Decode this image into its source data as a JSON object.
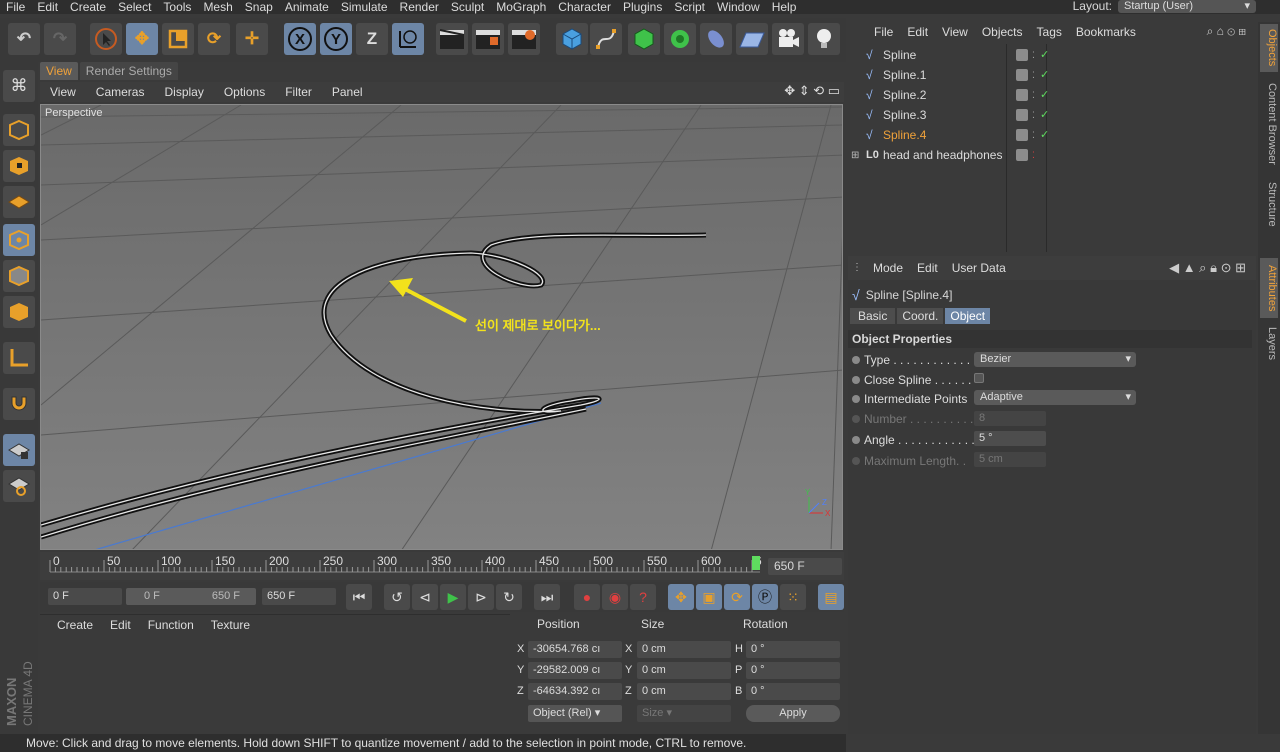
{
  "menubar": {
    "items": [
      "File",
      "Edit",
      "Create",
      "Select",
      "Tools",
      "Mesh",
      "Snap",
      "Animate",
      "Simulate",
      "Render",
      "Sculpt",
      "MoGraph",
      "Character",
      "Plugins",
      "Script",
      "Window",
      "Help"
    ],
    "layout_label": "Layout:",
    "layout_value": "Startup (User)"
  },
  "toolbar": {
    "icons": [
      "undo-icon",
      "redo-icon",
      "live-selection-icon",
      "move-icon",
      "scale-icon",
      "rotate-icon",
      "recent-tools-icon",
      "x-axis-lock",
      "y-axis-lock",
      "z-axis-lock",
      "world-coordinates-icon",
      "render-view-icon",
      "render-picture-viewer-icon",
      "edit-render-settings-icon",
      "cube-icon",
      "pen-icon",
      "subdivision-surface-icon",
      "array-icon",
      "deformer-icon",
      "floor-icon",
      "camera-icon",
      "light-icon"
    ],
    "x_label": "X",
    "y_label": "Y",
    "z_label": "Z"
  },
  "viewport": {
    "tabs": [
      "View",
      "Render Settings"
    ],
    "menu": [
      "View",
      "Cameras",
      "Display",
      "Options",
      "Filter",
      "Panel"
    ],
    "label": "Perspective",
    "annotation": "선이 제대로 보이다가..."
  },
  "timeline": {
    "ticks": [
      "0",
      "50",
      "100",
      "150",
      "200",
      "250",
      "300",
      "350",
      "400",
      "450",
      "500",
      "550",
      "600",
      "6"
    ],
    "end_field": "650 F"
  },
  "transport": {
    "start": "0 F",
    "range_start": "0 F",
    "range_end": "650 F",
    "end": "650 F"
  },
  "material": {
    "menu": [
      "Create",
      "Edit",
      "Function",
      "Texture"
    ]
  },
  "coordinates": {
    "headers": [
      "Position",
      "Size",
      "Rotation"
    ],
    "rows": [
      {
        "axis": "X",
        "pos": "-30654.768 cı",
        "size_axis": "X",
        "size": "0 cm",
        "rot_axis": "H",
        "rot": "0 °"
      },
      {
        "axis": "Y",
        "pos": "-29582.009 cı",
        "size_axis": "Y",
        "size": "0 cm",
        "rot_axis": "P",
        "rot": "0 °"
      },
      {
        "axis": "Z",
        "pos": "-64634.392 cı",
        "size_axis": "Z",
        "size": "0 cm",
        "rot_axis": "B",
        "rot": "0 °"
      }
    ],
    "mode": "Object (Rel)",
    "size_mode": "Size",
    "apply": "Apply"
  },
  "status": "Move: Click and drag to move elements. Hold down SHIFT to quantize movement / add to the selection in point mode, CTRL to remove.",
  "objects": {
    "menu": [
      "File",
      "Edit",
      "View",
      "Objects",
      "Tags",
      "Bookmarks"
    ],
    "items": [
      {
        "name": "Spline",
        "selected": false
      },
      {
        "name": "Spline.1",
        "selected": false
      },
      {
        "name": "Spline.2",
        "selected": false
      },
      {
        "name": "Spline.3",
        "selected": false
      },
      {
        "name": "Spline.4",
        "selected": true
      },
      {
        "name": "head and headphones",
        "selected": false
      }
    ]
  },
  "attributes": {
    "menu": [
      "Mode",
      "Edit",
      "User Data"
    ],
    "title": "Spline [Spline.4]",
    "tabs": [
      "Basic",
      "Coord.",
      "Object"
    ],
    "section": "Object Properties",
    "props": {
      "type_label": "Type . . . . . . . . . . . .",
      "type_value": "Bezier",
      "close_label": "Close Spline . . . . . .",
      "inter_label": "Intermediate Points",
      "inter_value": "Adaptive",
      "number_label": "Number . . . . . . . . . .",
      "number_value": "8",
      "angle_label": "Angle . . . . . . . . . . . .",
      "angle_value": "5 °",
      "maxlen_label": "Maximum Length. .",
      "maxlen_value": "5 cm"
    }
  },
  "right_tabs": [
    "Objects",
    "Content Browser",
    "Structure",
    "Attributes",
    "Layers"
  ],
  "brand": {
    "line1": "MAXON",
    "line2": "CINEMA 4D"
  },
  "colors": {
    "accent": "#f0a23a",
    "selected_blue": "#6d86a6",
    "check_green": "#5fdc5f",
    "arrow_yellow": "#f2e21c"
  }
}
